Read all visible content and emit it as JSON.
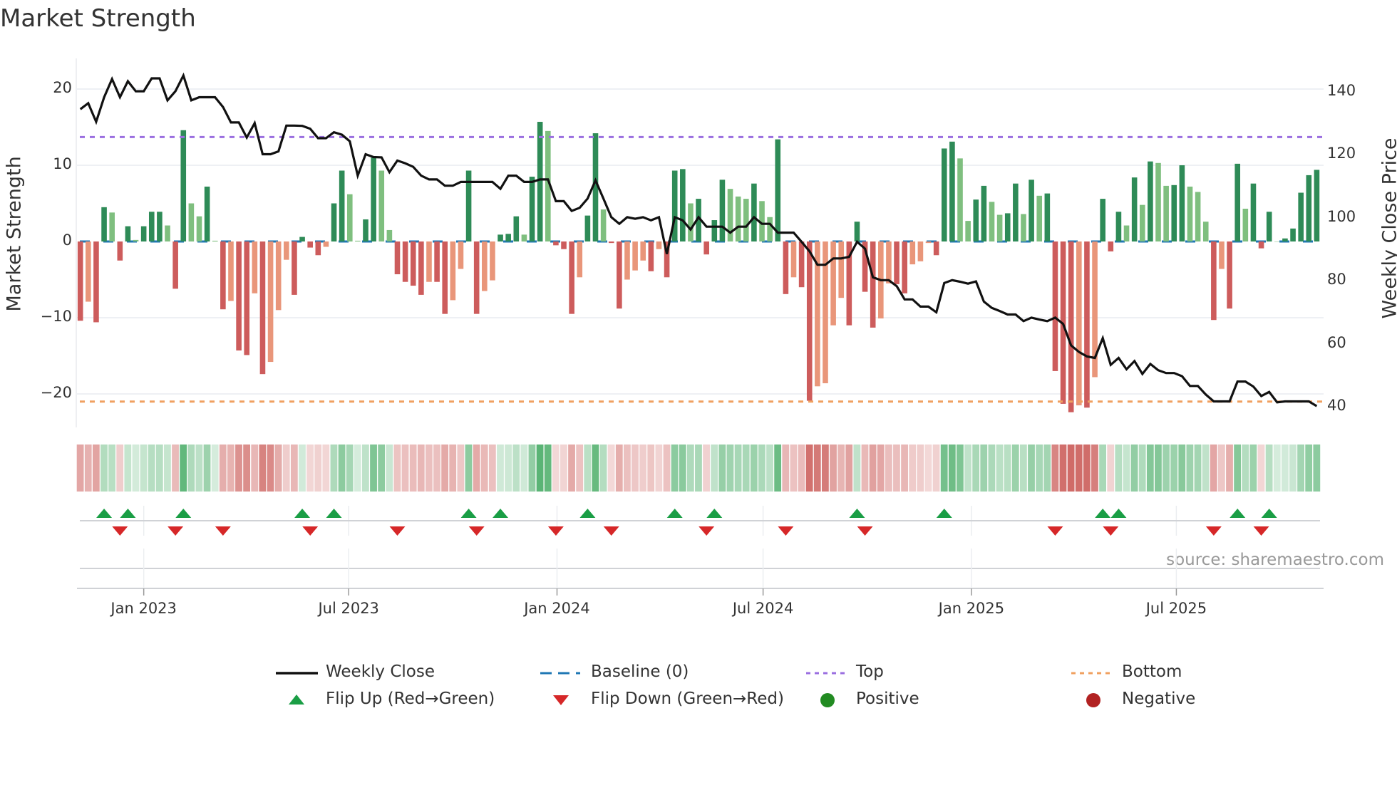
{
  "title": "Market Strength",
  "source": "source: sharemaestro.com",
  "colors": {
    "close": "#111111",
    "baseline": "#1f77b4",
    "top": "#9b6fe0",
    "bottom": "#f0a060",
    "bar_pos_up": "#2e8b57",
    "bar_pos_down": "#7fbf7f",
    "bar_neg_down": "#cd5c5c",
    "bar_neg_up": "#e9967a",
    "flip_up": "#1a9e45",
    "flip_down": "#d62728",
    "positive": "#228b22",
    "negative": "#b22222"
  },
  "chart_data": {
    "type": "bar",
    "title": "Market Strength",
    "ylabel": "Market Strength",
    "y2label": "Weekly Close Price",
    "ylim": [
      -24.5,
      24.5
    ],
    "y2lim": [
      37,
      150
    ],
    "yticks": [
      20,
      10,
      0,
      -10,
      -20
    ],
    "ytick_labels": [
      "20",
      "10",
      "0",
      "−10",
      "−20"
    ],
    "y2ticks": [
      140,
      120,
      100,
      80,
      60,
      40
    ],
    "y2tick_labels": [
      "140",
      "120",
      "100",
      "80",
      "60",
      "40"
    ],
    "x_start": "2022-11-06",
    "x_step_days": 7,
    "xticks": [
      {
        "date": "2023-01-01",
        "label": "Jan 2023"
      },
      {
        "date": "2023-07-01",
        "label": "Jul 2023"
      },
      {
        "date": "2024-01-01",
        "label": "Jan 2024"
      },
      {
        "date": "2024-07-01",
        "label": "Jul 2024"
      },
      {
        "date": "2025-01-01",
        "label": "Jan 2025"
      },
      {
        "date": "2025-07-01",
        "label": "Jul 2025"
      }
    ],
    "top_level": 13.7,
    "bottom_level": -21.0,
    "baseline": 0,
    "strength": [
      -10.4,
      -7.9,
      -10.6,
      4.5,
      3.8,
      -2.5,
      2.0,
      0.2,
      2.0,
      3.9,
      3.9,
      2.1,
      -6.2,
      14.6,
      5.0,
      3.3,
      7.2,
      0.1,
      -8.9,
      -7.8,
      -14.3,
      -14.9,
      -6.8,
      -17.4,
      -15.8,
      -9.0,
      -2.4,
      -7.0,
      0.6,
      -0.8,
      -1.8,
      -0.7,
      5.0,
      9.3,
      6.2,
      0.1,
      2.9,
      11.0,
      9.3,
      1.5,
      -4.3,
      -5.3,
      -5.8,
      -7.0,
      -5.3,
      -5.3,
      -9.5,
      -7.7,
      -3.6,
      9.3,
      -9.5,
      -6.5,
      -5.1,
      0.9,
      1.0,
      3.3,
      0.9,
      8.5,
      15.7,
      14.5,
      -0.5,
      -1.0,
      -9.5,
      -4.7,
      3.4,
      14.2,
      4.2,
      -0.2,
      -8.8,
      -5.0,
      -3.8,
      -2.5,
      -3.9,
      -1.0,
      -4.7,
      9.3,
      9.5,
      5.0,
      5.6,
      -1.7,
      2.8,
      8.1,
      6.9,
      5.9,
      5.6,
      7.6,
      5.3,
      3.2,
      13.4,
      -6.9,
      -4.7,
      -6.0,
      -20.9,
      -19.0,
      -18.6,
      -11.0,
      -7.4,
      -11.0,
      2.6,
      -6.6,
      -11.3,
      -10.1,
      -5.5,
      -5.6,
      -6.8,
      -3.0,
      -2.6,
      -0.2,
      -1.8,
      12.2,
      13.1,
      10.9,
      2.7,
      5.5,
      7.3,
      5.2,
      3.5,
      3.7,
      7.6,
      3.6,
      8.1,
      6.0,
      6.3,
      -17.0,
      -21.3,
      -22.4,
      -21.5,
      -21.8,
      -17.8,
      5.6,
      -1.3,
      3.9,
      2.1,
      8.4,
      4.8,
      10.5,
      10.3,
      7.3,
      7.4,
      10.0,
      7.2,
      6.5,
      2.6,
      -10.3,
      -3.6,
      -8.8,
      10.2,
      4.3,
      7.6,
      -0.9,
      3.9,
      0,
      0.4,
      1.7,
      6.4,
      8.7,
      9.4
    ],
    "weekly_close": [
      134.5,
      136.4,
      130.5,
      138.3,
      144.1,
      138.3,
      143.4,
      140.2,
      140.2,
      144.3,
      144.3,
      137.3,
      140.2,
      145.2,
      137.3,
      138.3,
      138.3,
      138.3,
      135.2,
      130.3,
      130.3,
      125.5,
      130.1,
      120.2,
      120.2,
      121.1,
      129.3,
      129.3,
      129.2,
      128.3,
      125.3,
      125.3,
      127.2,
      126.4,
      124.3,
      113.4,
      120.2,
      119.3,
      119.2,
      114.5,
      118.2,
      117.3,
      116.2,
      113.4,
      112.2,
      112.2,
      110.2,
      110.2,
      111.4,
      111.4,
      111.4,
      111.4,
      111.4,
      109.2,
      113.4,
      113.4,
      111.4,
      111.4,
      112.2,
      112.2,
      105.3,
      105.3,
      102.2,
      103.2,
      106.1,
      111.9,
      106.1,
      100.2,
      98.1,
      100.2,
      99.7,
      100.2,
      99.2,
      100.2,
      88.5,
      100.2,
      99.2,
      96.3,
      100.2,
      97.2,
      97.2,
      97.2,
      95.3,
      97.2,
      97.2,
      100.2,
      98.1,
      98.1,
      95.3,
      95.3,
      95.3,
      92.4,
      89.4,
      85.1,
      85.1,
      87.1,
      87.1,
      87.6,
      92.4,
      90.2,
      81.1,
      80.2,
      80.2,
      78.3,
      74.1,
      74.1,
      71.8,
      71.8,
      70.0,
      79.3,
      80.2,
      79.7,
      79.1,
      79.8,
      73.4,
      71.4,
      70.4,
      69.3,
      69.3,
      67.2,
      68.3,
      67.7,
      67.2,
      68.3,
      66.3,
      59.5,
      57.4,
      56.0,
      55.5,
      61.8,
      53.3,
      55.5,
      51.9,
      54.5,
      50.4,
      53.6,
      51.6,
      50.7,
      50.7,
      49.7,
      46.6,
      46.6,
      43.9,
      41.7,
      41.7,
      41.7,
      48.0,
      48.0,
      46.4,
      43.4,
      44.7,
      41.4,
      41.7,
      41.7,
      41.7,
      41.7,
      40.2
    ],
    "flip_up_weeks": [
      3,
      6,
      13,
      28,
      32,
      49,
      53,
      64,
      75,
      80,
      98,
      109,
      129,
      131,
      146,
      150
    ],
    "flip_down_weeks": [
      5,
      12,
      18,
      29,
      40,
      50,
      60,
      67,
      79,
      89,
      99,
      123,
      130,
      143,
      149
    ],
    "legend": {
      "placement": "bottom",
      "items": [
        {
          "key": "close",
          "label": "Weekly Close"
        },
        {
          "key": "baseline",
          "label": "Baseline (0)"
        },
        {
          "key": "top",
          "label": "Top"
        },
        {
          "key": "bottom",
          "label": "Bottom"
        },
        {
          "key": "flip_up",
          "label": "Flip Up (Red→Green)"
        },
        {
          "key": "flip_down",
          "label": "Flip Down (Green→Red)"
        },
        {
          "key": "positive",
          "label": "Positive"
        },
        {
          "key": "negative",
          "label": "Negative"
        }
      ]
    }
  }
}
